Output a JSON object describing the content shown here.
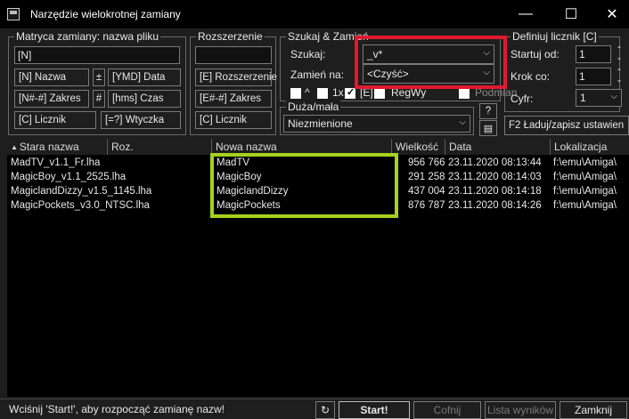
{
  "window": {
    "title": "Narzędzie wielokrotnej zamiany",
    "minimize": "—",
    "maximize": "☐",
    "close": "✕"
  },
  "mask": {
    "legend": "Matryca zamiany: nazwa pliku",
    "value": "[N]",
    "buttons": [
      "[N]  Nazwa",
      "±",
      "[YMD]  Data",
      "[N#-#]  Zakres",
      "#",
      "[hms]  Czas",
      "[C]  Licznik",
      "[=?]  Wtyczka"
    ]
  },
  "ext": {
    "legend": "Rozszerzenie",
    "value": "",
    "buttons": [
      "[E]  Rozszerzenie",
      "[E#-#]  Zakres",
      "[C]  Licznik"
    ]
  },
  "search": {
    "legend": "Szukaj & Zamień",
    "search_label": "Szukaj:",
    "search_value": "_v*",
    "replace_label": "Zamień na:",
    "replace_value": "<Czyść>",
    "opt1": "^",
    "opt2": "1x",
    "opt3": "[E]",
    "opt4": "RegWy",
    "opt5": "Podmian"
  },
  "case": {
    "legend": "Duża/mała",
    "value": "Niezmienione",
    "help": "?"
  },
  "counter": {
    "legend": "Definiuj licznik [C]",
    "start_label": "Startuj od:",
    "start_value": "1",
    "step_label": "Krok co:",
    "step_value": "1",
    "digits_label": "Cyfr:",
    "digits_value": "1",
    "load_save": "F2 Ładuj/zapisz ustawien"
  },
  "columns": [
    "Stara nazwa",
    "Roz.",
    "Nowa nazwa",
    "Wielkość",
    "Data",
    "Lokalizacja"
  ],
  "rows": [
    {
      "old": "MadTV_v1.1_Fr.lha",
      "new": "MadTV",
      "size": "956 766",
      "date": "23.11.2020 08:13:44",
      "loc": "f:\\emu\\Amiga\\"
    },
    {
      "old": "MagicBoy_v1.1_2525.lha",
      "new": "MagicBoy",
      "size": "291 258",
      "date": "23.11.2020 08:14:03",
      "loc": "f:\\emu\\Amiga\\"
    },
    {
      "old": "MagiclandDizzy_v1.5_1145.lha",
      "new": "MagiclandDizzy",
      "size": "437 004",
      "date": "23.11.2020 08:14:18",
      "loc": "f:\\emu\\Amiga\\"
    },
    {
      "old": "MagicPockets_v3.0_NTSC.lha",
      "new": "MagicPockets",
      "size": "876 787",
      "date": "23.11.2020 08:14:26",
      "loc": "f:\\emu\\Amiga\\"
    }
  ],
  "status": {
    "text": "Wciśnij 'Start!', aby rozpocząć zamianę nazw!",
    "start": "Start!",
    "undo": "Cofnij",
    "results": "Lista wyników",
    "close": "Zamknij"
  }
}
